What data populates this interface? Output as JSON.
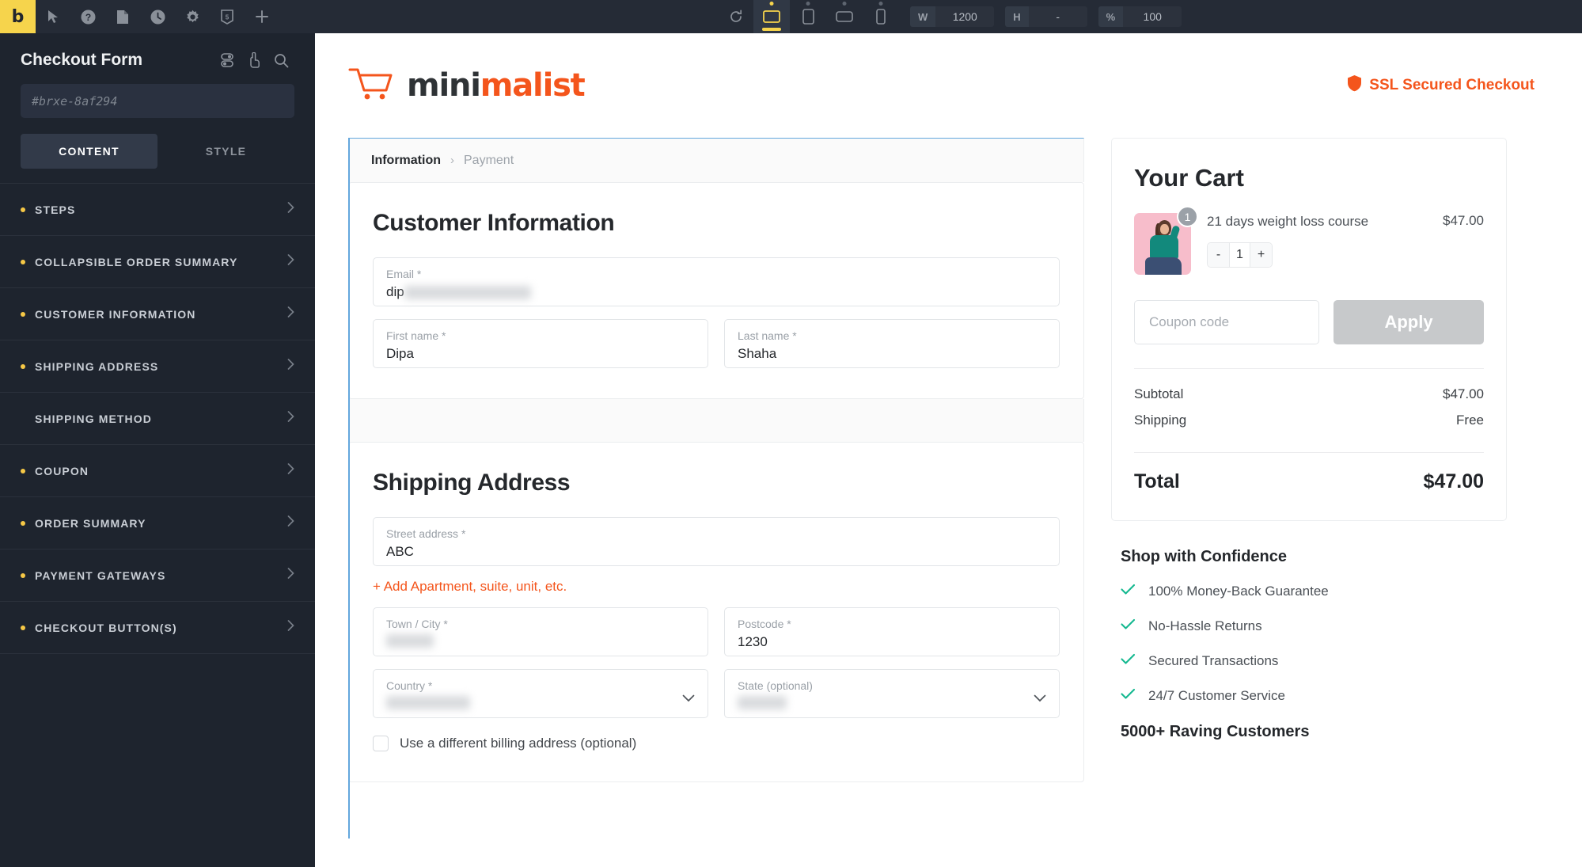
{
  "toolbar": {
    "logo_letter": "b",
    "left_icons": [
      "cursor-icon",
      "help-icon",
      "pages-icon",
      "history-icon",
      "settings-icon",
      "css-icon",
      "add-icon"
    ],
    "refresh_icon": "refresh-icon",
    "devices": [
      {
        "name": "desktop",
        "active": true
      },
      {
        "name": "tablet-portrait",
        "active": false
      },
      {
        "name": "tablet-landscape",
        "active": false
      },
      {
        "name": "mobile",
        "active": false
      }
    ],
    "width": {
      "label": "W",
      "value": "1200"
    },
    "height": {
      "label": "H",
      "value": "-"
    },
    "zoom": {
      "label": "%",
      "value": "100"
    },
    "accent": "#f6d44c"
  },
  "sidebar": {
    "title": "Checkout Form",
    "element_id": "#brxe-8af294",
    "tabs": [
      {
        "label": "CONTENT",
        "active": true
      },
      {
        "label": "STYLE",
        "active": false
      }
    ],
    "items": [
      {
        "label": "STEPS",
        "dot": true
      },
      {
        "label": "COLLAPSIBLE ORDER SUMMARY",
        "dot": true
      },
      {
        "label": "CUSTOMER INFORMATION",
        "dot": true
      },
      {
        "label": "SHIPPING ADDRESS",
        "dot": true
      },
      {
        "label": "SHIPPING METHOD",
        "dot": false
      },
      {
        "label": "COUPON",
        "dot": true
      },
      {
        "label": "ORDER SUMMARY",
        "dot": true
      },
      {
        "label": "PAYMENT GATEWAYS",
        "dot": true
      },
      {
        "label": "CHECKOUT BUTTON(S)",
        "dot": true
      }
    ]
  },
  "site": {
    "logo": {
      "part1": "mini",
      "part2": "malist"
    },
    "ssl_text": "SSL Secured Checkout",
    "accent": "#f4551c"
  },
  "steps": {
    "current": "Information",
    "separator": "›",
    "next": "Payment"
  },
  "customer": {
    "heading": "Customer Information",
    "email": {
      "label": "Email *",
      "value": "dip",
      "redacted": true
    },
    "first_name": {
      "label": "First name *",
      "value": "Dipa"
    },
    "last_name": {
      "label": "Last name *",
      "value": "Shaha"
    }
  },
  "shipping": {
    "heading": "Shipping Address",
    "street": {
      "label": "Street address *",
      "value": "ABC"
    },
    "add_apartment": "+ Add Apartment, suite, unit, etc.",
    "city": {
      "label": "Town / City *",
      "value": "",
      "redacted": true
    },
    "postcode": {
      "label": "Postcode *",
      "value": "1230"
    },
    "country": {
      "label": "Country *",
      "value": "",
      "redacted": true
    },
    "state": {
      "label": "State (optional)",
      "value": "",
      "redacted": true
    },
    "billing_checkbox": {
      "label": "Use a different billing address (optional)",
      "checked": false
    }
  },
  "cart": {
    "heading": "Your Cart",
    "item": {
      "name": "21 days weight loss course",
      "price": "$47.00",
      "badge": "1",
      "qty": "1",
      "minus": "-",
      "plus": "+"
    },
    "coupon_placeholder": "Coupon code",
    "apply_label": "Apply",
    "subtotal": {
      "label": "Subtotal",
      "value": "$47.00"
    },
    "shipping": {
      "label": "Shipping",
      "value": "Free"
    },
    "total": {
      "label": "Total",
      "value": "$47.00"
    }
  },
  "trust": {
    "heading": "Shop with Confidence",
    "items": [
      "100% Money-Back Guarantee",
      "No-Hassle Returns",
      "Secured Transactions",
      "24/7 Customer Service"
    ],
    "footer": "5000+ Raving Customers",
    "check_color": "#14b88f"
  }
}
